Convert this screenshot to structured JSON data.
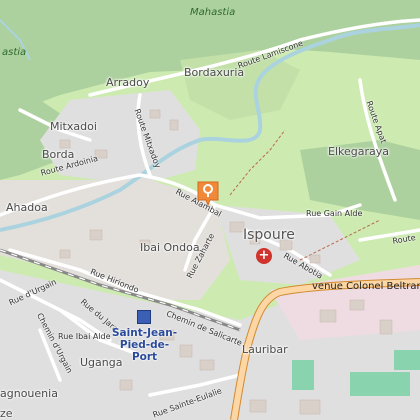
{
  "map": {
    "labels": {
      "mahastia": "Mahastia",
      "astia": "astia",
      "arradoy": "Arradoy",
      "bordaxuria": "Bordaxuria",
      "route_lamiscone": "Route Lamiscone",
      "mitxadoi": "Mitxadoi",
      "route_mitxadoy": "Route Mitxadoy",
      "borda": "Borda",
      "route_ardoinia": "Route Ardoinia",
      "route_apat": "Route Apat",
      "elkegaraya": "Elkegaraya",
      "ahadoa": "Ahadoa",
      "rue_alambal": "Rue Alambal",
      "rue_gain_alde": "Rue Gain Alde",
      "route_right": "Route",
      "ispoure": "Ispoure",
      "ibai_ondoa": "Ibai Ondoa",
      "rue_zaharte": "Rue Zaharte",
      "rue_abotia": "Rue Abotia",
      "avenue_colonel": "venue Colonel Beltrame",
      "rue_hiriondo": "Rue Hiriondo",
      "rue_urgain": "Rue d'Urgain",
      "chemin_urgain": "Chemin d'Urgain",
      "rue_du_jara": "Rue du Jara",
      "chemin_salicarte": "Chemin de Salicarte",
      "rue_ibai_alde": "Rue Ibai Alde",
      "uganga": "Uganga",
      "lauribar": "Lauribar",
      "rue_sainte_eulalie": "Rue Sainte-Eulalie",
      "agnouenia": "agnouenia",
      "ze": "ze",
      "station": "Saint-Jean-Pied-de-Port",
      "station_line1": "Saint-Jean-",
      "station_line2": "Pied-de-",
      "station_line3": "Port"
    },
    "markers": {
      "selected_pin": "map-pin-icon",
      "health": "hospital-cross-icon",
      "health_symbol": "+",
      "railway": "railway-station-icon"
    },
    "colors": {
      "forest": "#add19e",
      "meadow": "#cdebb0",
      "residential": "#e0dfdf",
      "river": "#aad3df",
      "primary_road": "#fcd6a4",
      "primary_casing": "#d18a2f",
      "pin": "#f08a3a",
      "health": "#d0342c",
      "station": "#3b5fb5"
    }
  }
}
